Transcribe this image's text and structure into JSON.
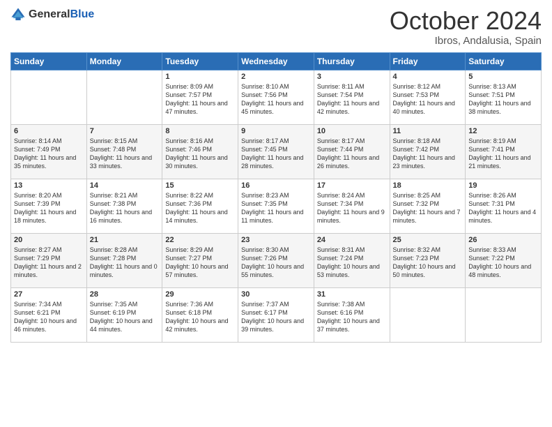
{
  "logo": {
    "general": "General",
    "blue": "Blue"
  },
  "title": "October 2024",
  "location": "Ibros, Andalusia, Spain",
  "headers": [
    "Sunday",
    "Monday",
    "Tuesday",
    "Wednesday",
    "Thursday",
    "Friday",
    "Saturday"
  ],
  "weeks": [
    [
      {
        "day": "",
        "info": ""
      },
      {
        "day": "",
        "info": ""
      },
      {
        "day": "1",
        "info": "Sunrise: 8:09 AM\nSunset: 7:57 PM\nDaylight: 11 hours and 47 minutes."
      },
      {
        "day": "2",
        "info": "Sunrise: 8:10 AM\nSunset: 7:56 PM\nDaylight: 11 hours and 45 minutes."
      },
      {
        "day": "3",
        "info": "Sunrise: 8:11 AM\nSunset: 7:54 PM\nDaylight: 11 hours and 42 minutes."
      },
      {
        "day": "4",
        "info": "Sunrise: 8:12 AM\nSunset: 7:53 PM\nDaylight: 11 hours and 40 minutes."
      },
      {
        "day": "5",
        "info": "Sunrise: 8:13 AM\nSunset: 7:51 PM\nDaylight: 11 hours and 38 minutes."
      }
    ],
    [
      {
        "day": "6",
        "info": "Sunrise: 8:14 AM\nSunset: 7:49 PM\nDaylight: 11 hours and 35 minutes."
      },
      {
        "day": "7",
        "info": "Sunrise: 8:15 AM\nSunset: 7:48 PM\nDaylight: 11 hours and 33 minutes."
      },
      {
        "day": "8",
        "info": "Sunrise: 8:16 AM\nSunset: 7:46 PM\nDaylight: 11 hours and 30 minutes."
      },
      {
        "day": "9",
        "info": "Sunrise: 8:17 AM\nSunset: 7:45 PM\nDaylight: 11 hours and 28 minutes."
      },
      {
        "day": "10",
        "info": "Sunrise: 8:17 AM\nSunset: 7:44 PM\nDaylight: 11 hours and 26 minutes."
      },
      {
        "day": "11",
        "info": "Sunrise: 8:18 AM\nSunset: 7:42 PM\nDaylight: 11 hours and 23 minutes."
      },
      {
        "day": "12",
        "info": "Sunrise: 8:19 AM\nSunset: 7:41 PM\nDaylight: 11 hours and 21 minutes."
      }
    ],
    [
      {
        "day": "13",
        "info": "Sunrise: 8:20 AM\nSunset: 7:39 PM\nDaylight: 11 hours and 18 minutes."
      },
      {
        "day": "14",
        "info": "Sunrise: 8:21 AM\nSunset: 7:38 PM\nDaylight: 11 hours and 16 minutes."
      },
      {
        "day": "15",
        "info": "Sunrise: 8:22 AM\nSunset: 7:36 PM\nDaylight: 11 hours and 14 minutes."
      },
      {
        "day": "16",
        "info": "Sunrise: 8:23 AM\nSunset: 7:35 PM\nDaylight: 11 hours and 11 minutes."
      },
      {
        "day": "17",
        "info": "Sunrise: 8:24 AM\nSunset: 7:34 PM\nDaylight: 11 hours and 9 minutes."
      },
      {
        "day": "18",
        "info": "Sunrise: 8:25 AM\nSunset: 7:32 PM\nDaylight: 11 hours and 7 minutes."
      },
      {
        "day": "19",
        "info": "Sunrise: 8:26 AM\nSunset: 7:31 PM\nDaylight: 11 hours and 4 minutes."
      }
    ],
    [
      {
        "day": "20",
        "info": "Sunrise: 8:27 AM\nSunset: 7:29 PM\nDaylight: 11 hours and 2 minutes."
      },
      {
        "day": "21",
        "info": "Sunrise: 8:28 AM\nSunset: 7:28 PM\nDaylight: 11 hours and 0 minutes."
      },
      {
        "day": "22",
        "info": "Sunrise: 8:29 AM\nSunset: 7:27 PM\nDaylight: 10 hours and 57 minutes."
      },
      {
        "day": "23",
        "info": "Sunrise: 8:30 AM\nSunset: 7:26 PM\nDaylight: 10 hours and 55 minutes."
      },
      {
        "day": "24",
        "info": "Sunrise: 8:31 AM\nSunset: 7:24 PM\nDaylight: 10 hours and 53 minutes."
      },
      {
        "day": "25",
        "info": "Sunrise: 8:32 AM\nSunset: 7:23 PM\nDaylight: 10 hours and 50 minutes."
      },
      {
        "day": "26",
        "info": "Sunrise: 8:33 AM\nSunset: 7:22 PM\nDaylight: 10 hours and 48 minutes."
      }
    ],
    [
      {
        "day": "27",
        "info": "Sunrise: 7:34 AM\nSunset: 6:21 PM\nDaylight: 10 hours and 46 minutes."
      },
      {
        "day": "28",
        "info": "Sunrise: 7:35 AM\nSunset: 6:19 PM\nDaylight: 10 hours and 44 minutes."
      },
      {
        "day": "29",
        "info": "Sunrise: 7:36 AM\nSunset: 6:18 PM\nDaylight: 10 hours and 42 minutes."
      },
      {
        "day": "30",
        "info": "Sunrise: 7:37 AM\nSunset: 6:17 PM\nDaylight: 10 hours and 39 minutes."
      },
      {
        "day": "31",
        "info": "Sunrise: 7:38 AM\nSunset: 6:16 PM\nDaylight: 10 hours and 37 minutes."
      },
      {
        "day": "",
        "info": ""
      },
      {
        "day": "",
        "info": ""
      }
    ]
  ]
}
